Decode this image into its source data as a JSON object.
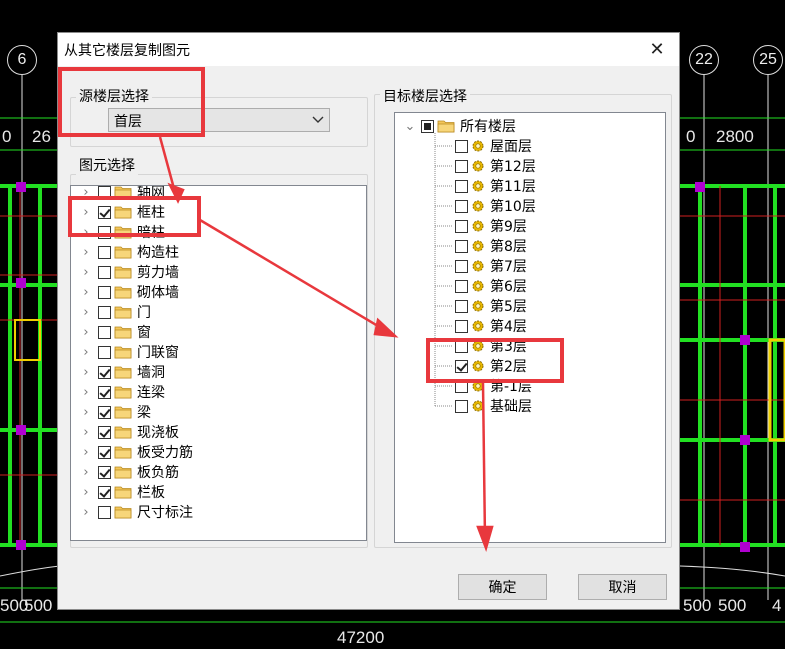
{
  "colors": {
    "highlight": "#e8383d",
    "cad_green": "#22e022",
    "cad_red": "#d12020",
    "cad_magenta": "#b000d0",
    "cad_yellow": "#f0d000"
  },
  "cad": {
    "axis_labels": [
      "6",
      "22",
      "25"
    ],
    "dimensions_top": [
      "0",
      "26",
      "0",
      "2800"
    ],
    "dimensions_bottom": [
      "500",
      "500",
      "500",
      "500",
      "4"
    ],
    "total_dimension": "47200"
  },
  "dialog": {
    "title": "从其它楼层复制图元",
    "close_icon": "close-icon",
    "source_group": {
      "label": "源楼层选择",
      "selected": "首层"
    },
    "element_group": {
      "label": "图元选择",
      "items": [
        {
          "label": "轴网",
          "checked": false
        },
        {
          "label": "框柱",
          "checked": true
        },
        {
          "label": "暗柱",
          "checked": false
        },
        {
          "label": "构造柱",
          "checked": false
        },
        {
          "label": "剪力墙",
          "checked": false
        },
        {
          "label": "砌体墙",
          "checked": false
        },
        {
          "label": "门",
          "checked": false
        },
        {
          "label": "窗",
          "checked": false
        },
        {
          "label": "门联窗",
          "checked": false
        },
        {
          "label": "墙洞",
          "checked": true
        },
        {
          "label": "连梁",
          "checked": true
        },
        {
          "label": "梁",
          "checked": true
        },
        {
          "label": "现浇板",
          "checked": true
        },
        {
          "label": "板受力筋",
          "checked": true
        },
        {
          "label": "板负筋",
          "checked": true
        },
        {
          "label": "栏板",
          "checked": true
        },
        {
          "label": "尺寸标注",
          "checked": false
        }
      ]
    },
    "target_group": {
      "label": "目标楼层选择",
      "root": {
        "label": "所有楼层",
        "state": "partial"
      },
      "floors": [
        {
          "label": "屋面层",
          "checked": false
        },
        {
          "label": "第12层",
          "checked": false
        },
        {
          "label": "第11层",
          "checked": false
        },
        {
          "label": "第10层",
          "checked": false
        },
        {
          "label": "第9层",
          "checked": false
        },
        {
          "label": "第8层",
          "checked": false
        },
        {
          "label": "第7层",
          "checked": false
        },
        {
          "label": "第6层",
          "checked": false
        },
        {
          "label": "第5层",
          "checked": false
        },
        {
          "label": "第4层",
          "checked": false
        },
        {
          "label": "第3层",
          "checked": false
        },
        {
          "label": "第2层",
          "checked": true
        },
        {
          "label": "第-1层",
          "checked": false
        },
        {
          "label": "基础层",
          "checked": false
        }
      ]
    },
    "buttons": {
      "ok": "确定",
      "cancel": "取消"
    }
  }
}
